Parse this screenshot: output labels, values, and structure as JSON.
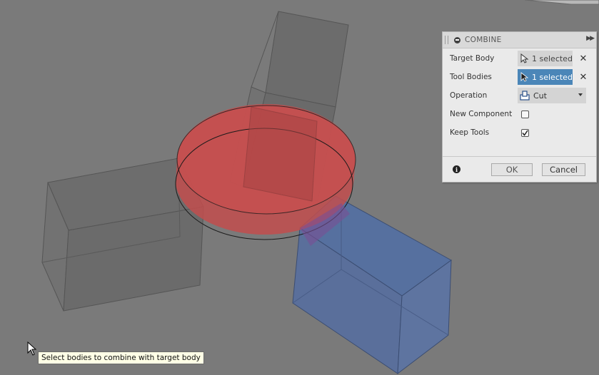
{
  "panel": {
    "title": "COMBINE",
    "target_body": {
      "label": "Target Body",
      "selection": "1 selected"
    },
    "tool_bodies": {
      "label": "Tool Bodies",
      "selection": "1 selected"
    },
    "operation": {
      "label": "Operation",
      "value": "Cut"
    },
    "new_component": {
      "label": "New Component",
      "checked": false
    },
    "keep_tools": {
      "label": "Keep Tools",
      "checked": true
    },
    "ok_label": "OK",
    "cancel_label": "Cancel",
    "info_glyph": "i"
  },
  "tooltip": {
    "text": "Select bodies to combine with target body"
  },
  "colors": {
    "canvas_bg": "#7a7a7a",
    "target_body": "#c84c4c",
    "tool_body": "#5b72a0",
    "active_selection": "#4b86b8"
  },
  "icons": [
    "collapse-icon",
    "expand-icon",
    "select-cursor-icon",
    "clear-icon",
    "cut-operation-icon",
    "info-icon",
    "mouse-pointer-icon"
  ]
}
